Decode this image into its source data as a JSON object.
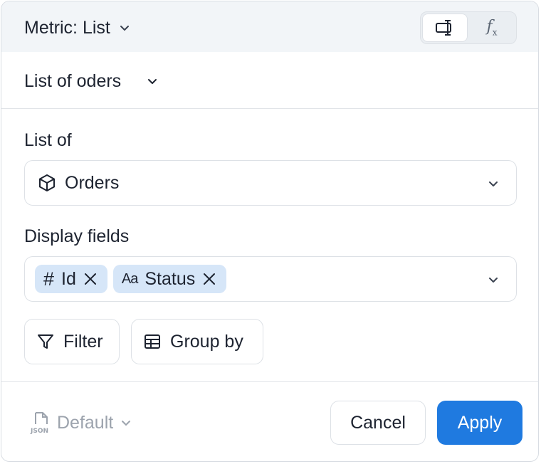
{
  "header": {
    "metric_label": "Metric: List",
    "function_glyph": "f",
    "function_sub": "x"
  },
  "title": {
    "text": "List of oders"
  },
  "list_of": {
    "label": "List of",
    "value": "Orders",
    "icon": "cube-icon"
  },
  "display_fields": {
    "label": "Display fields",
    "chips": [
      {
        "icon_text": "#",
        "label": "Id"
      },
      {
        "icon_text": "Aa",
        "label": "Status"
      }
    ]
  },
  "actions": {
    "filter_label": "Filter",
    "group_by_label": "Group by"
  },
  "footer": {
    "format_label": "Default",
    "json_badge": "JSON",
    "cancel_label": "Cancel",
    "apply_label": "Apply"
  },
  "colors": {
    "accent": "#1f7ae0",
    "chip_bg": "#d6e6f8",
    "header_bg": "#f2f5f8"
  }
}
